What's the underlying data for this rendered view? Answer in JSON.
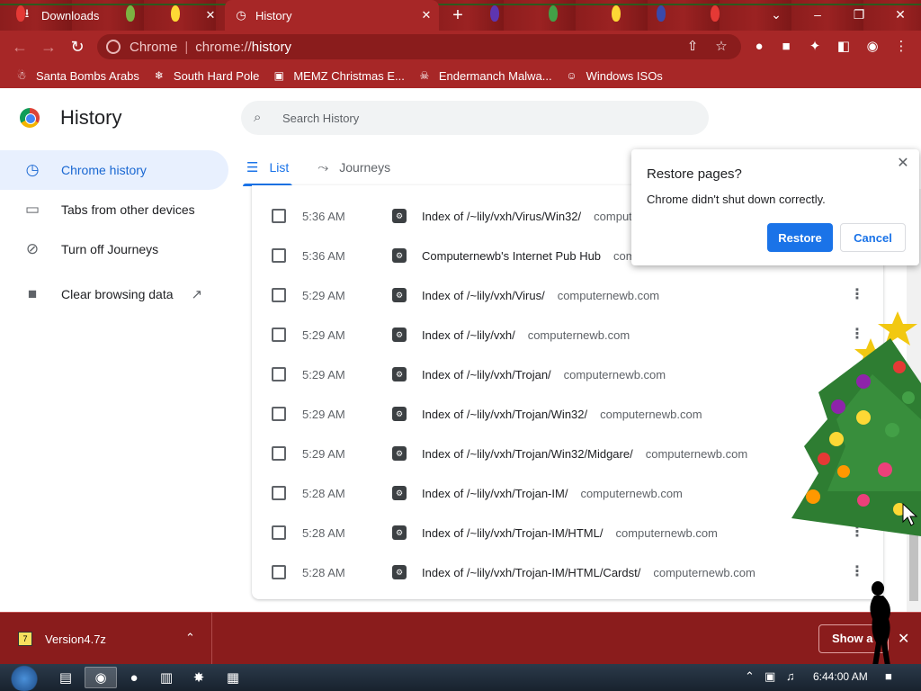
{
  "tabs": [
    {
      "title": "Downloads",
      "icon": "download-icon",
      "active": false
    },
    {
      "title": "History",
      "icon": "history-icon",
      "active": true
    }
  ],
  "omnibox": {
    "label": "Chrome",
    "scheme": "chrome://",
    "path": "history"
  },
  "bookmarks": [
    {
      "label": "Santa Bombs Arabs",
      "icon": "santa-icon"
    },
    {
      "label": "South Hard Pole",
      "icon": "snowflake-icon"
    },
    {
      "label": "MEMZ Christmas E...",
      "icon": "image-icon"
    },
    {
      "label": "Endermanch Malwa...",
      "icon": "skull-icon"
    },
    {
      "label": "Windows ISOs",
      "icon": "elf-icon"
    }
  ],
  "page": {
    "title": "History",
    "search_placeholder": "Search History"
  },
  "sidebar": {
    "items": [
      {
        "label": "Chrome history",
        "icon": "clock-icon",
        "active": true
      },
      {
        "label": "Tabs from other devices",
        "icon": "devices-icon",
        "active": false
      },
      {
        "label": "Turn off Journeys",
        "icon": "journeys-off-icon",
        "active": false
      },
      {
        "label": "Clear browsing data",
        "icon": "trash-icon",
        "active": false
      }
    ]
  },
  "page_tabs": [
    {
      "label": "List",
      "icon": "list-icon",
      "active": true
    },
    {
      "label": "Journeys",
      "icon": "journeys-icon",
      "active": false
    }
  ],
  "history": [
    {
      "time": "5:36 AM",
      "title": "Index of /~lily/vxh/Virus/Win32/",
      "domain": "computernewb.com"
    },
    {
      "time": "5:36 AM",
      "title": "Computernewb's Internet Pub Hub",
      "domain": "computernewb.com"
    },
    {
      "time": "5:29 AM",
      "title": "Index of /~lily/vxh/Virus/",
      "domain": "computernewb.com"
    },
    {
      "time": "5:29 AM",
      "title": "Index of /~lily/vxh/",
      "domain": "computernewb.com"
    },
    {
      "time": "5:29 AM",
      "title": "Index of /~lily/vxh/Trojan/",
      "domain": "computernewb.com"
    },
    {
      "time": "5:29 AM",
      "title": "Index of /~lily/vxh/Trojan/Win32/",
      "domain": "computernewb.com"
    },
    {
      "time": "5:29 AM",
      "title": "Index of /~lily/vxh/Trojan/Win32/Midgare/",
      "domain": "computernewb.com"
    },
    {
      "time": "5:28 AM",
      "title": "Index of /~lily/vxh/Trojan-IM/",
      "domain": "computernewb.com"
    },
    {
      "time": "5:28 AM",
      "title": "Index of /~lily/vxh/Trojan-IM/HTML/",
      "domain": "computernewb.com"
    },
    {
      "time": "5:28 AM",
      "title": "Index of /~lily/vxh/Trojan-IM/HTML/Cardst/",
      "domain": "computernewb.com"
    }
  ],
  "dialog": {
    "title": "Restore pages?",
    "message": "Chrome didn't shut down correctly.",
    "restore_label": "Restore",
    "cancel_label": "Cancel"
  },
  "download_shelf": {
    "filename": "Version4.7z",
    "show_all_label": "Show a"
  },
  "taskbar": {
    "clock": "6:44:00 AM"
  },
  "colors": {
    "theme_red": "#a72727",
    "accent_blue": "#1a73e8",
    "active_nav_bg": "#e8f0fe"
  }
}
